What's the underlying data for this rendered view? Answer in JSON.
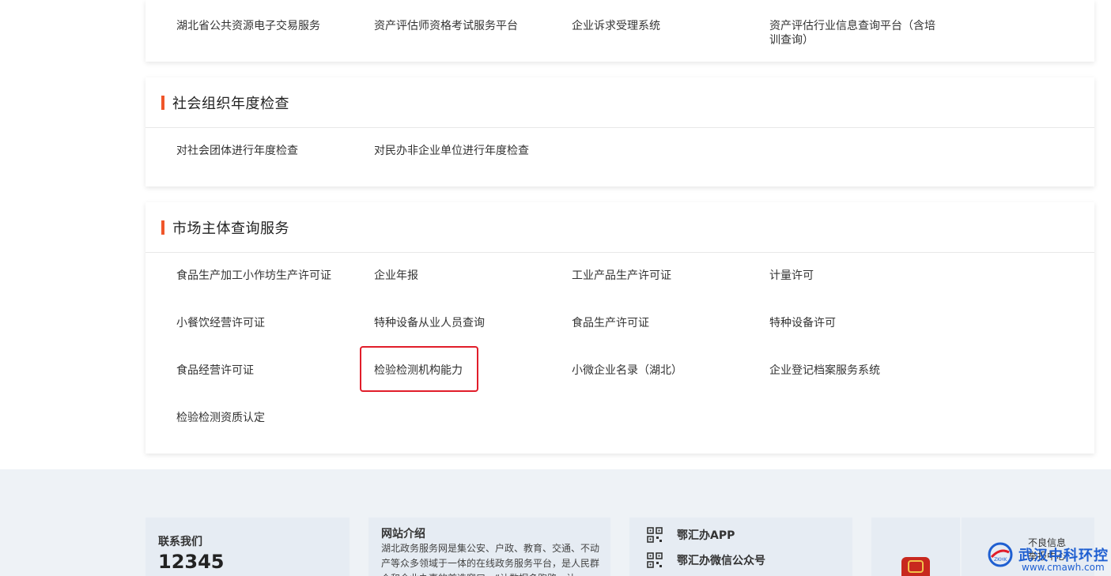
{
  "top_card": {
    "items": [
      "湖北省公共资源电子交易服务",
      "资产评估师资格考试服务平台",
      "企业诉求受理系统",
      "资产评估行业信息查询平台（含培训查询）"
    ]
  },
  "annual_card": {
    "title": "社会组织年度检查",
    "items": [
      "对社会团体进行年度检查",
      "对民办非企业单位进行年度检查"
    ]
  },
  "market_card": {
    "title": "市场主体查询服务",
    "items": [
      "食品生产加工小作坊生产许可证",
      "企业年报",
      "工业产品生产许可证",
      "计量许可",
      "小餐饮经营许可证",
      "特种设备从业人员查询",
      "食品生产许可证",
      "特种设备许可",
      "食品经营许可证",
      "检验检测机构能力",
      "小微企业名录（湖北）",
      "企业登记档案服务系统",
      "检验检测资质认定"
    ]
  },
  "footer": {
    "contact_label": "联系我们",
    "contact_number": "12345",
    "intro_title": "网站介绍",
    "intro_text": "湖北政务服务网是集公安、户政、教育、交通、不动产等众多领域于一体的在线政务服务平台，是人民群众和企业办事的首选窗口，“让数据多跑路，让",
    "app_label": "鄂汇办APP",
    "wechat_label": "鄂汇办微信公众号",
    "report_line1": "不良信息",
    "report_line2": "举报中心"
  },
  "watermark": {
    "name": "武汉中科环控",
    "url": "www.cmawh.com"
  },
  "colors": {
    "accent_bar": "#f0562a",
    "highlight_border": "#e11d2a",
    "footer_bg": "#eef2f6",
    "watermark_blue": "#1f5fd1"
  }
}
